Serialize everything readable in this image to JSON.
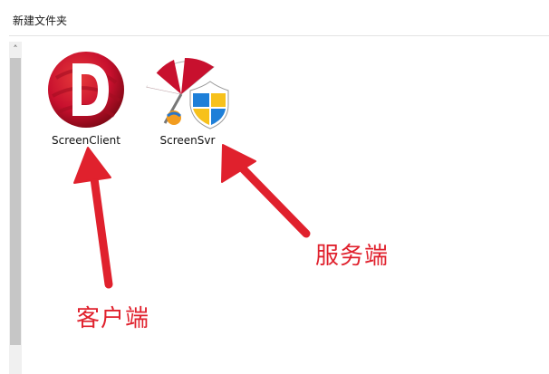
{
  "header": {
    "folder_title": "新建文件夹"
  },
  "scrollbar": {
    "up_icon": "chevron-up-icon"
  },
  "files": [
    {
      "name": "ScreenClient",
      "icon": "screenclient-app-icon"
    },
    {
      "name": "ScreenSvr",
      "icon": "screensaver-parasol-shield-icon"
    }
  ],
  "annotations": {
    "client_label": "客户端",
    "server_label": "服务端"
  },
  "colors": {
    "annotation_red": "#e0212d",
    "app_red": "#c8102e",
    "shield_blue": "#1e7fd8",
    "shield_yellow": "#f7c11b"
  }
}
